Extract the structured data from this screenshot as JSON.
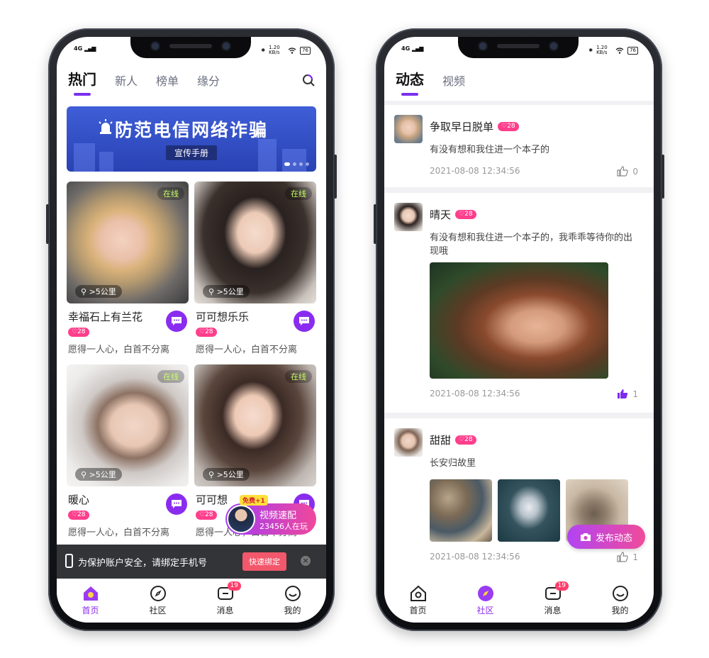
{
  "status": {
    "left": "4G",
    "right_speed": "1.20 KB/s",
    "battery": "76"
  },
  "home": {
    "tabs": [
      "热门",
      "新人",
      "榜单",
      "缘分"
    ],
    "banner": {
      "title": "防范电信网络诈骗",
      "subtitle": "宣传手册"
    },
    "cards": [
      {
        "name": "幸福石上有兰花",
        "online": "在线",
        "distance": ">5公里",
        "badge": "28",
        "motto": "愿得一人心，白首不分离"
      },
      {
        "name": "可可想乐乐",
        "online": "在线",
        "distance": ">5公里",
        "badge": "28",
        "motto": "愿得一人心，白首不分离"
      },
      {
        "name": "暖心",
        "online": "在线",
        "distance": ">5公里",
        "badge": "28",
        "motto": "愿得一人心，白首不分离"
      },
      {
        "name": "可可想",
        "online": "在线",
        "distance": ">5公里",
        "badge": "28",
        "motto": "愿得一人心，白首不分离"
      }
    ],
    "video_match": {
      "free_tag": "免费+1",
      "title": "视频速配",
      "subtitle": "23456人在玩"
    },
    "bind_bar": {
      "text": "为保护账户安全，请绑定手机号",
      "button": "快速绑定",
      "close": "×"
    }
  },
  "community": {
    "tabs": [
      "动态",
      "视频"
    ],
    "posts": [
      {
        "name": "争取早日脱单",
        "badge": "28",
        "text": "有没有想和我住进一个本子的",
        "time": "2021-08-08 12:34:56",
        "likes": "0"
      },
      {
        "name": "晴天",
        "badge": "28",
        "text": "有没有想和我住进一个本子的，我乖乖等待你的出现哦",
        "time": "2021-08-08 12:34:56",
        "likes": "1"
      },
      {
        "name": "甜甜",
        "badge": "28",
        "text": "长安归故里",
        "time": "2021-08-08 12:34:56",
        "likes": "1"
      }
    ],
    "publish_button": "发布动态"
  },
  "nav": {
    "items": [
      "首页",
      "社区",
      "消息",
      "我的"
    ],
    "message_badge": "19"
  },
  "colors": {
    "accent": "#8a2cf0",
    "pink": "#ff3e8c",
    "online_green": "#c6ff66"
  }
}
